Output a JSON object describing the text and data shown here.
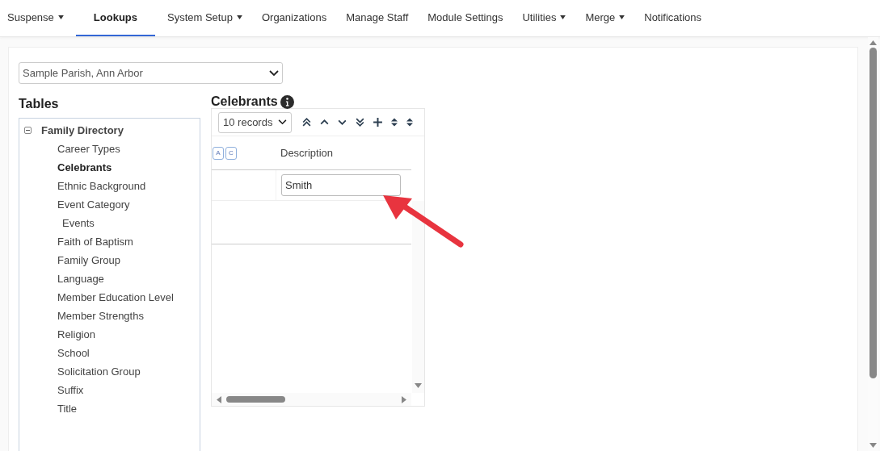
{
  "nav": [
    {
      "label": "Suspense",
      "dropdown": true,
      "selected": false
    },
    {
      "label": "Lookups",
      "dropdown": false,
      "selected": true
    },
    {
      "label": "System Setup",
      "dropdown": true,
      "selected": false
    },
    {
      "label": "Organizations",
      "dropdown": false,
      "selected": false
    },
    {
      "label": "Manage Staff",
      "dropdown": false,
      "selected": false
    },
    {
      "label": "Module Settings",
      "dropdown": false,
      "selected": false
    },
    {
      "label": "Utilities",
      "dropdown": true,
      "selected": false
    },
    {
      "label": "Merge",
      "dropdown": true,
      "selected": false
    },
    {
      "label": "Notifications",
      "dropdown": false,
      "selected": false
    }
  ],
  "parish_select": {
    "value": "Sample Parish, Ann Arbor"
  },
  "tables": {
    "title": "Tables",
    "tree": [
      {
        "label": "Family Directory",
        "expanded": true,
        "selected": false,
        "children": [
          {
            "label": "Career Types",
            "selected": false
          },
          {
            "label": "Celebrants",
            "selected": true
          },
          {
            "label": "Ethnic Background",
            "selected": false
          },
          {
            "label": "Event Category",
            "selected": false,
            "children": [
              {
                "label": "Events",
                "selected": false
              }
            ]
          },
          {
            "label": "Faith of Baptism",
            "selected": false
          },
          {
            "label": "Family Group",
            "selected": false
          },
          {
            "label": "Language",
            "selected": false
          },
          {
            "label": "Member Education Level",
            "selected": false
          },
          {
            "label": "Member Strengths",
            "selected": false
          },
          {
            "label": "Religion",
            "selected": false
          },
          {
            "label": "School",
            "selected": false
          },
          {
            "label": "Solicitation Group",
            "selected": false
          },
          {
            "label": "Suffix",
            "selected": false
          },
          {
            "label": "Title",
            "selected": false
          }
        ]
      }
    ]
  },
  "grid": {
    "title": "Celebrants",
    "page_size": "10 records",
    "badges": [
      "A",
      "C"
    ],
    "columns": [
      "Description"
    ],
    "rows": [
      {
        "description": "Smith"
      }
    ]
  }
}
